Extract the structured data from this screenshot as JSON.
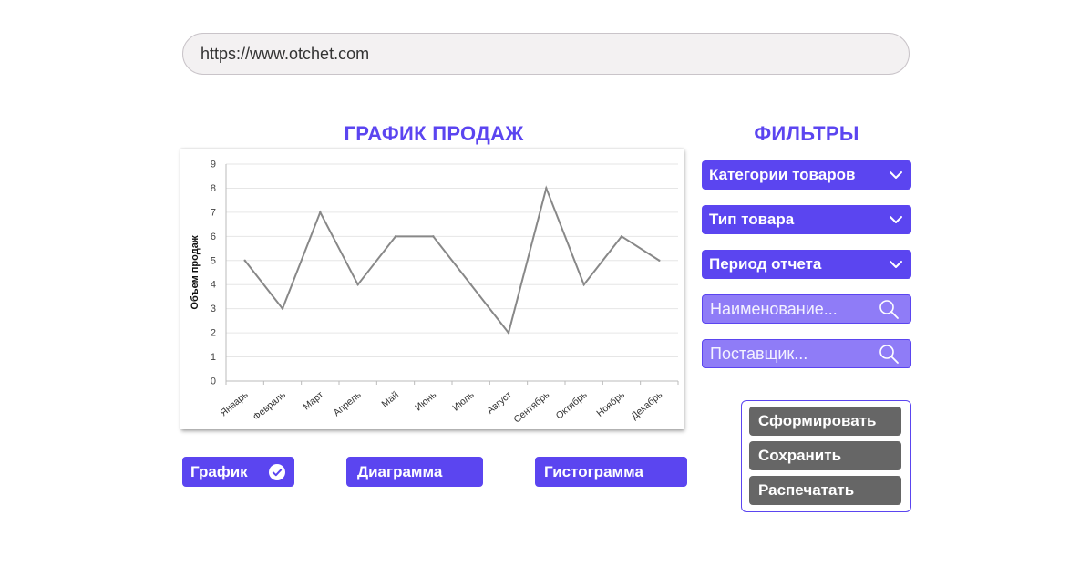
{
  "url_bar": {
    "url": "https://www.otchet.com"
  },
  "chart_section": {
    "title": "ГРАФИК ПРОДАЖ"
  },
  "chart_data": {
    "type": "line",
    "ylabel": "Объем продаж",
    "xlabel": "",
    "ylim": [
      0,
      9
    ],
    "y_ticks": [
      "0",
      "1",
      "2",
      "3",
      "4",
      "5",
      "6",
      "7",
      "8",
      "9"
    ],
    "categories": [
      "Январь",
      "Февраль",
      "Март",
      "Апрель",
      "Май",
      "Июнь",
      "Июль",
      "Август",
      "Сентябрь",
      "Октябрь",
      "Ноябрь",
      "Декабрь"
    ],
    "values": [
      5,
      3,
      7,
      4,
      6,
      6,
      4,
      2,
      8,
      4,
      6,
      5
    ],
    "grid": true,
    "line_color": "#888888"
  },
  "filters": {
    "title": "ФИЛЬТРЫ",
    "dropdowns": [
      {
        "label": "Категории товаров",
        "icon": "chevron-down-icon"
      },
      {
        "label": "Тип товара",
        "icon": "chevron-down-icon"
      },
      {
        "label": "Период отчета",
        "icon": "chevron-down-icon"
      }
    ],
    "search_name": {
      "placeholder": "Наименование...",
      "value": "",
      "icon": "search-icon"
    },
    "search_supplier": {
      "placeholder": "Поставщик...",
      "value": "",
      "icon": "search-icon"
    }
  },
  "chart_types": [
    {
      "label": "График",
      "selected": true,
      "icon": "check-circle-icon"
    },
    {
      "label": "Диаграмма",
      "selected": false
    },
    {
      "label": "Гистограмма",
      "selected": false
    }
  ],
  "actions": {
    "generate": "Сформировать",
    "save": "Сохранить",
    "print": "Распечатать"
  },
  "colors": {
    "accent": "#5b45f0",
    "search_fill": "#8f7cf7",
    "action_button": "#666666",
    "url_bar_bg": "#f3f1f2"
  }
}
